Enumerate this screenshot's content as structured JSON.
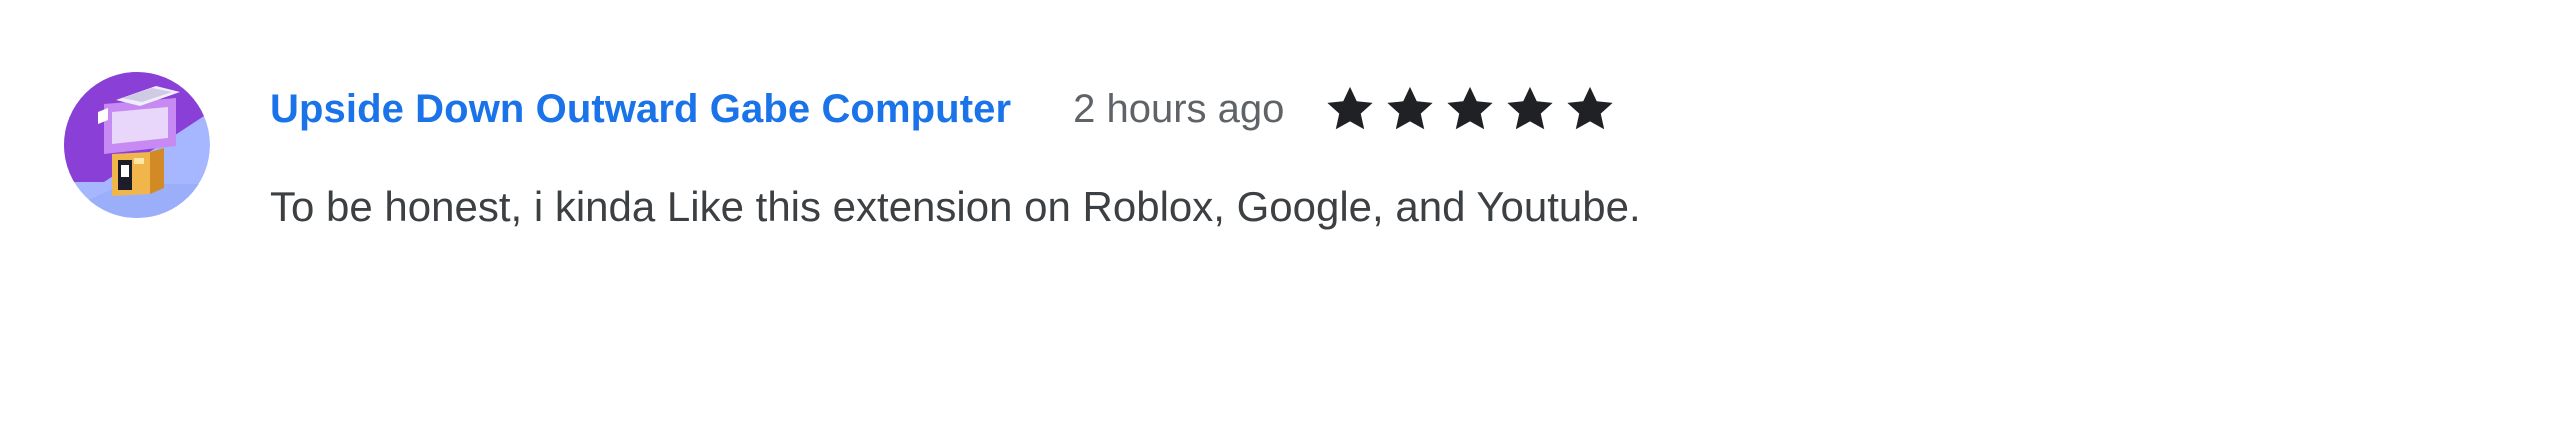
{
  "review": {
    "author_name": "Upside Down Outward Gabe Computer",
    "timestamp": "2 hours ago",
    "rating": 5,
    "rating_max": 5,
    "text": "To be honest, i kinda Like this extension on Roblox, Google, and Youtube.",
    "avatar_icon": "retro-computer-avatar-icon",
    "colors": {
      "author_link": "#1a73e8",
      "timestamp": "#5f6368",
      "body_text": "#3c4043",
      "star_filled": "#202124",
      "avatar_background": "#a6b6ff",
      "avatar_accent": "#8a3fd6"
    }
  }
}
